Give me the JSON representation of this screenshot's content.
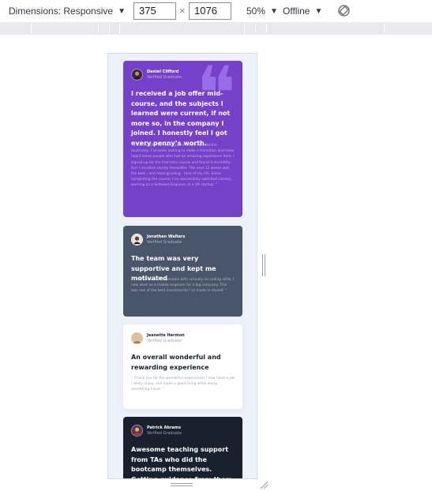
{
  "toolbar": {
    "dimensions_label": "Dimensions: Responsive",
    "width_value": "375",
    "height_value": "1076",
    "times_symbol": "×",
    "zoom": "50%",
    "throttling": "Offline"
  },
  "testimonials": [
    {
      "name": "Daniel Clifford",
      "role": "Verified Graduate",
      "headline": "I received a job offer mid-course, and the subjects I learned were current, if not more so, in the company I joined. I honestly feel I got every penny’s worth.",
      "quote": "“ I was an EMT for many years before I joined the bootcamp. I’ve been looking to make a transition and have heard some people who had an amazing experience here. I signed up for the free intro course and found it incredibly fun! I enrolled shortly thereafter. The next 12 weeks was the best - and most grueling - time of my life. Since completing the course, I’ve successfully switched careers, working as a Software Engineer at a VR startup. ”"
    },
    {
      "name": "Jonathan Walters",
      "role": "Verified Graduate",
      "headline": "The team was very supportive and kept me motivated",
      "quote": "“ I started as a total newbie with virtually no coding skills. I now work as a mobile engineer for a big company. This was one of the best investments I’ve made in myself. ”"
    },
    {
      "name": "Jeanette Harmon",
      "role": "Verified Graduate",
      "headline": "An overall wonderful and rewarding experience",
      "quote": "“ Thank you for the wonderful experience! I now have a job I really enjoy, and make a good living while doing something I love. ”"
    },
    {
      "name": "Patrick Abrams",
      "role": "Verified Graduate",
      "headline": "Awesome teaching support from TAs who did the bootcamp themselves. Getting guidance from them and learning from their experiences was easy.",
      "quote": ""
    }
  ],
  "colors": {
    "purple": "#7541c8",
    "grayish_blue": "#48556a",
    "white": "#ffffff",
    "dark_blue": "#19212e",
    "page_bg": "#edf1fa"
  },
  "icons": {
    "dropdown": "chevron-down-icon",
    "rotate": "rotate-icon",
    "quote": "quote-mark-icon"
  }
}
